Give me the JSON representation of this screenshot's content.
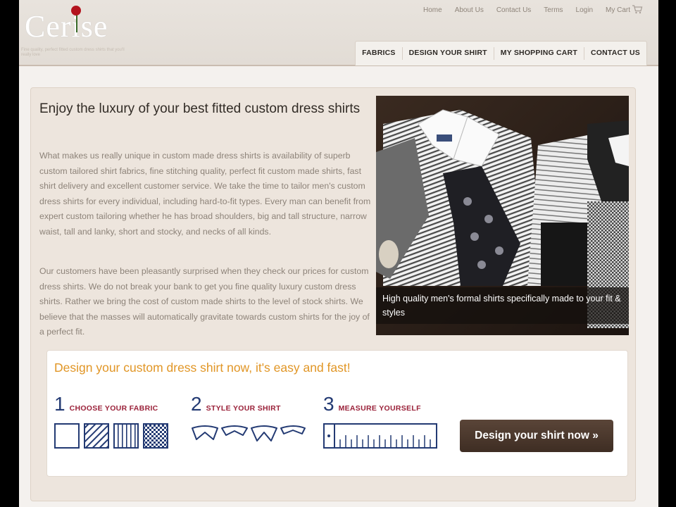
{
  "brand": {
    "logo": "Cerise",
    "tagline": "Fine quality, perfect fitted custom dress shirts that you'll really love"
  },
  "top_nav": [
    "Home",
    "About Us",
    "Contact Us",
    "Terms",
    "Login",
    "My Cart"
  ],
  "main_nav": [
    "FABRICS",
    "DESIGN YOUR SHIRT",
    "MY SHOPPING CART",
    "CONTACT US"
  ],
  "intro": {
    "title": "Enjoy the luxury of your best fitted custom dress shirts",
    "paragraph1": "What makes us really unique in custom made dress shirts is availability of superb custom tailored shirt fabrics, fine stitching quality, perfect fit custom made shirts, fast shirt delivery and excellent customer service. We take the time to tailor men's custom dress shirts for every individual, including hard-to-fit types. Every man can benefit from expert custom tailoring whether he has broad shoulders, big and tall structure, narrow waist, tall and lanky, short and stocky, and necks of all kinds.",
    "paragraph2": "Our customers have been pleasantly surprised when they check our prices for custom dress shirts. We do not break your bank to get you fine quality luxury custom dress shirts. Rather we bring the cost of custom made shirts to the level of stock shirts. We believe that the masses will automatically gravitate towards custom shirts for the joy of a perfect fit."
  },
  "photo": {
    "caption": "High quality men's formal shirts specifically made to your fit & styles"
  },
  "design": {
    "title": "Design your custom dress shirt now, it's easy and fast!",
    "steps": [
      {
        "number": "1",
        "label": "CHOOSE YOUR FABRIC"
      },
      {
        "number": "2",
        "label": "STYLE YOUR SHIRT"
      },
      {
        "number": "3",
        "label": "MEASURE YOURSELF"
      }
    ],
    "cta": "Design your shirt now »"
  },
  "colors": {
    "accent_orange": "#e19626",
    "step_number_blue": "#233a73",
    "step_label_red": "#9a2139",
    "cta_brown": "#4a372b"
  }
}
